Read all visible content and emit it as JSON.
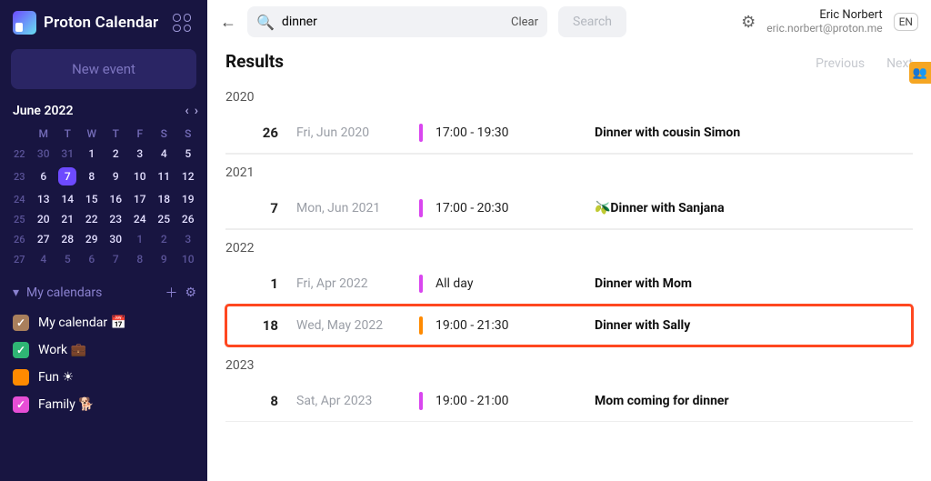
{
  "brand": "Proton Calendar",
  "new_event_label": "New event",
  "month_label": "June 2022",
  "dow": [
    "M",
    "T",
    "W",
    "T",
    "F",
    "S",
    "S"
  ],
  "weeks": [
    {
      "wk": "22",
      "days": [
        {
          "n": "30",
          "out": true
        },
        {
          "n": "31",
          "out": true
        },
        {
          "n": "1"
        },
        {
          "n": "2"
        },
        {
          "n": "3"
        },
        {
          "n": "4"
        },
        {
          "n": "5"
        }
      ]
    },
    {
      "wk": "23",
      "days": [
        {
          "n": "6"
        },
        {
          "n": "7",
          "today": true
        },
        {
          "n": "8"
        },
        {
          "n": "9"
        },
        {
          "n": "10"
        },
        {
          "n": "11"
        },
        {
          "n": "12"
        }
      ]
    },
    {
      "wk": "24",
      "days": [
        {
          "n": "13"
        },
        {
          "n": "14"
        },
        {
          "n": "15"
        },
        {
          "n": "16"
        },
        {
          "n": "17"
        },
        {
          "n": "18"
        },
        {
          "n": "19"
        }
      ]
    },
    {
      "wk": "25",
      "days": [
        {
          "n": "20"
        },
        {
          "n": "21"
        },
        {
          "n": "22"
        },
        {
          "n": "23"
        },
        {
          "n": "24"
        },
        {
          "n": "25"
        },
        {
          "n": "26"
        }
      ]
    },
    {
      "wk": "26",
      "days": [
        {
          "n": "27"
        },
        {
          "n": "28"
        },
        {
          "n": "29"
        },
        {
          "n": "30"
        },
        {
          "n": "1",
          "out": true
        },
        {
          "n": "2",
          "out": true
        },
        {
          "n": "3",
          "out": true
        }
      ]
    },
    {
      "wk": "27",
      "days": [
        {
          "n": "4",
          "out": true
        },
        {
          "n": "5",
          "out": true
        },
        {
          "n": "6",
          "out": true
        },
        {
          "n": "7",
          "out": true
        },
        {
          "n": "8",
          "out": true
        },
        {
          "n": "9",
          "out": true
        },
        {
          "n": "10",
          "out": true
        }
      ]
    }
  ],
  "my_cals_label": "My calendars",
  "calendars": [
    {
      "color": "#a97f5c",
      "label": "My calendar 📅",
      "checked": true
    },
    {
      "color": "#2fb574",
      "label": "Work 💼",
      "checked": true
    },
    {
      "color": "#ff8a00",
      "label": "Fun ☀",
      "checked": false
    },
    {
      "color": "#e64ed6",
      "label": "Family 🐕",
      "checked": true
    }
  ],
  "search": {
    "value": "dinner",
    "clear": "Clear",
    "button": "Search"
  },
  "user": {
    "name": "Eric Norbert",
    "mail": "eric.norbert@proton.me",
    "initials": "EN"
  },
  "results_label": "Results",
  "nav": {
    "prev": "Previous",
    "next": "Next"
  },
  "groups": [
    {
      "year": "2020",
      "events": [
        {
          "day": "26",
          "date": "Fri, Jun 2020",
          "bar": "#d946ef",
          "time": "17:00 - 19:30",
          "title": "Dinner with cousin Simon",
          "hl": false
        }
      ]
    },
    {
      "year": "2021",
      "events": [
        {
          "day": "7",
          "date": "Mon, Jun 2021",
          "bar": "#d946ef",
          "time": "17:00 - 20:30",
          "title": "🫒Dinner with Sanjana",
          "hl": false
        }
      ]
    },
    {
      "year": "2022",
      "events": [
        {
          "day": "1",
          "date": "Fri, Apr 2022",
          "bar": "#d946ef",
          "time": "All day",
          "title": "Dinner with Mom",
          "hl": false
        },
        {
          "day": "18",
          "date": "Wed, May 2022",
          "bar": "#ff8a00",
          "time": "19:00 - 21:30",
          "title": "Dinner with Sally",
          "hl": true
        }
      ]
    },
    {
      "year": "2023",
      "events": [
        {
          "day": "8",
          "date": "Sat, Apr 2023",
          "bar": "#d946ef",
          "time": "19:00 - 21:00",
          "title": "Mom coming for dinner",
          "hl": false
        }
      ]
    }
  ]
}
